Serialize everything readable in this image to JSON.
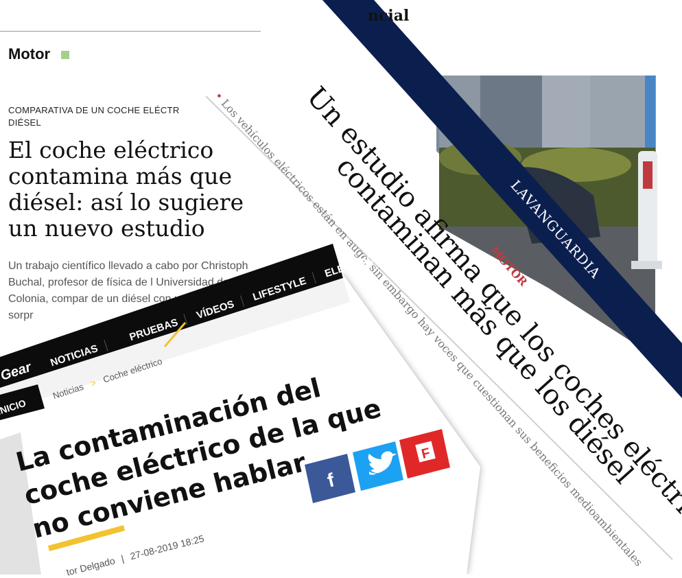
{
  "left_article": {
    "header_fragment": "ncial",
    "section": "Motor",
    "kicker": "COMPARATIVA DE UN COCHE ELÉCTR DIÉSEL",
    "title": "El coche eléctrico contamina más que un diésel: así lo sugiere un nuevo estudio",
    "lead": "Un trabajo científico llevado a cabo por Christoph Buchal, profesor de física de l Universidad de Colonia, compar de un diésel con un coch resultados sorpr",
    "square_color": "#a7cf8a"
  },
  "vanguardia": {
    "brand": "LAVANGUARDIA",
    "section": "MOTOR",
    "title_line1": "Un estudio afirma que los coches eléctricos",
    "title_line2": "contaminan más que los diésel",
    "bullet": "Los vehículos eléctricos están en auge, sin embargo hay voces que cuestionan sus beneficios medioambientales",
    "band_color": "#0b1f4f",
    "accent_color": "#c0393f"
  },
  "topgear": {
    "logo": "Gear",
    "nav": [
      "NOTICIAS",
      "PRUEBAS",
      "VÍDEOS",
      "LIFESTYLE",
      "ELÉCTRICO"
    ],
    "home": "INICIO",
    "breadcrumb": [
      "Noticias",
      ">",
      "Coche eléctrico"
    ],
    "title": "La contaminación del coche eléctrico de la que no conviene hablar",
    "byline": "tor Delgado",
    "date": "27-08-2019 18:25",
    "share": {
      "facebook_icon": "f",
      "twitter_icon": "twitter-bird",
      "flipboard_icon": "F"
    },
    "accent_color": "#f2c230"
  }
}
